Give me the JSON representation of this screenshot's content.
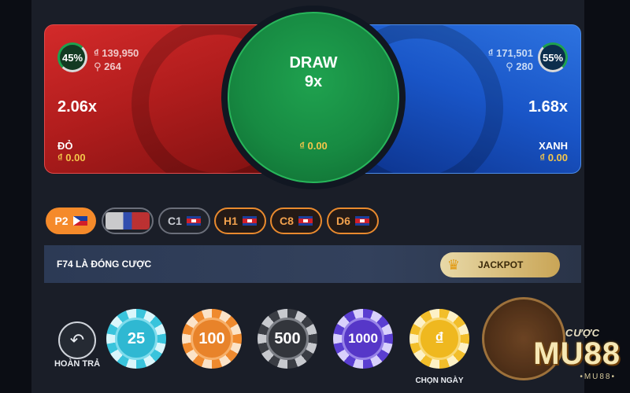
{
  "board": {
    "red": {
      "percent": "45%",
      "amount": "₫ 139,950",
      "players": "264",
      "multiplier": "2.06x",
      "label": "ĐỎ",
      "bet": "₫ 0.00"
    },
    "draw": {
      "title": "DRAW",
      "multiplier": "9x",
      "bet": "₫ 0.00"
    },
    "blue": {
      "percent": "55%",
      "amount": "₫ 171,501",
      "players": "280",
      "multiplier": "1.68x",
      "label": "XANH",
      "bet": "₫ 0.00"
    }
  },
  "history": [
    "P2",
    "",
    "C1",
    "H1",
    "C8",
    "D6"
  ],
  "status": {
    "text": "F74 LÀ ĐÓNG CƯỢC",
    "jackpot": "JACKPOT"
  },
  "chips": {
    "undo_label": "HOÀN TRẢ",
    "values": [
      "25",
      "100",
      "500",
      "1000"
    ],
    "custom_symbol": "₫",
    "custom_label": "CHỌN NGÀY"
  },
  "watermark": {
    "top": "CƯỢC",
    "main": "MU88",
    "sub": "•MU88•"
  }
}
